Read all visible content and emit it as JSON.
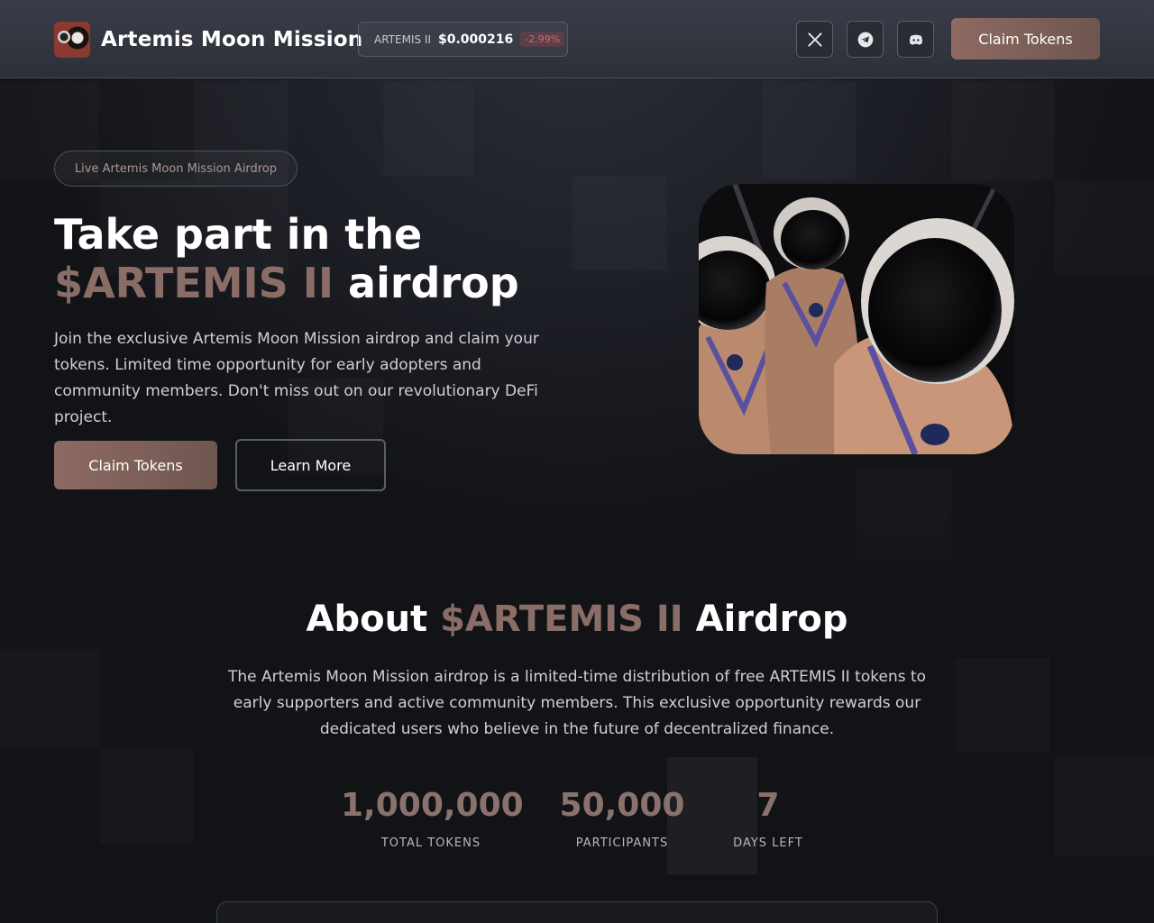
{
  "header": {
    "brand_name": "Artemis Moon Mission",
    "ticker": {
      "symbol": "ARTEMIS II",
      "price": "$0.000216",
      "change": "-2.99%"
    },
    "social": [
      {
        "icon": "x-icon"
      },
      {
        "icon": "telegram-icon"
      },
      {
        "icon": "discord-icon"
      }
    ],
    "claim_label": "Claim Tokens"
  },
  "hero": {
    "badge": "Live Artemis Moon Mission Airdrop",
    "title_line1": "Take part in the",
    "title_accent": "$ARTEMIS II",
    "title_line2_rest": " airdrop",
    "description": " Join the exclusive Artemis Moon Mission airdrop and claim your tokens. Limited time opportunity for early adopters and community members. Don't miss out on our revolutionary DeFi project.",
    "claim_label": "Claim Tokens",
    "learn_label": "Learn More"
  },
  "about": {
    "title_prefix": "About ",
    "title_accent": "$ARTEMIS II",
    "title_suffix": " Airdrop",
    "description": "The Artemis Moon Mission airdrop is a limited-time distribution of free ARTEMIS II tokens to early supporters and active community members. This exclusive opportunity rewards our dedicated users who believe in the future of decentralized finance.",
    "stats": [
      {
        "value": "1,000,000",
        "label": "TOTAL TOKENS"
      },
      {
        "value": "50,000",
        "label": "PARTICIPANTS"
      },
      {
        "value": "7",
        "label": "DAYS LEFT"
      }
    ]
  },
  "colors": {
    "accent": "#8a6d66",
    "button_gradient_start": "#8e6a62",
    "button_gradient_end": "#6e5650",
    "negative_change": "#e0646a",
    "background": "#121317"
  }
}
